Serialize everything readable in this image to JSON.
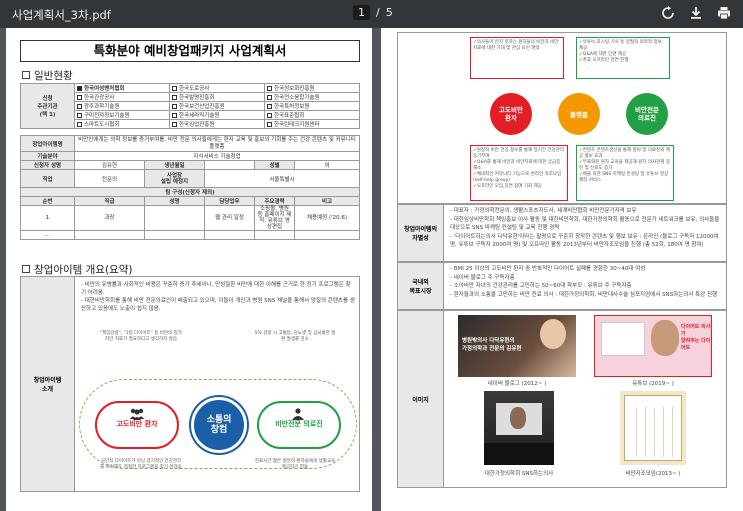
{
  "toolbar": {
    "filename": "사업계획서_3차.pdf",
    "current_page": "1",
    "separator": "/",
    "total_pages": "5"
  },
  "page1": {
    "heading": "특화분야 예비창업패키지 사업계획서",
    "general_title": "일반현황",
    "org_label": "신청\n주관기관\n(택 1)",
    "orgs": [
      {
        "name": "한국여성벤처협회",
        "checked": true
      },
      {
        "name": "한국도로공사",
        "checked": false
      },
      {
        "name": "한국정보화진흥원",
        "checked": false
      },
      {
        "name": "한국관광공사",
        "checked": false
      },
      {
        "name": "한국발명진흥회",
        "checked": false
      },
      {
        "name": "한국전소융합기술원",
        "checked": false
      },
      {
        "name": "광주과학기술원",
        "checked": false
      },
      {
        "name": "한국보건산업진흥원",
        "checked": false
      },
      {
        "name": "한국특허정보원",
        "checked": false
      },
      {
        "name": "구미전자정보기술원",
        "checked": false
      },
      {
        "name": "한국세라믹기술원",
        "checked": false
      },
      {
        "name": "한국표준협회",
        "checked": false
      },
      {
        "name": "스마트도시협회",
        "checked": false
      },
      {
        "name": "한국임업진흥원",
        "checked": false
      },
      {
        "name": "한국린테크지원센터",
        "checked": false
      }
    ],
    "idea_label": "창업아이템명",
    "idea_value": "비만인에게는 의학 정보를 증거부여를, 비만 전문 의사들에게는 환자 교육 및 홍보의 기회를 주는 건강 콘텐츠 및 커뮤니티 플랫폼",
    "tech_label": "기술분야",
    "tech_value": "지식서비스 기술창업",
    "applicant_label": "신청자 성명",
    "applicant_value": "김유현",
    "birth_label": "생년월일",
    "gender_label": "성별",
    "gender_value": "여",
    "job_label": "직업",
    "job_value": "전문의",
    "biz_place_label": "사업장\n설립 예정지",
    "biz_place_value": "서울특별시",
    "team_header": "팀 구성(신청자 제외)",
    "team_cols": [
      "순번",
      "직급",
      "성명",
      "담당업무",
      "주요경력",
      "비고"
    ],
    "team_rows": [
      [
        "1",
        "과장",
        "",
        "웹 관리 일정",
        "소핑몰, 병원 등 홈페이지 제작, 유튜브 영상편집",
        "채용예정 ('20.6)"
      ],
      [
        "...",
        "",
        "",
        "",
        "",
        ""
      ]
    ],
    "item_title": "창업아이템 개요(요약)",
    "item_label": "창업아이템\n소개",
    "item_text": [
      "- 비만의 유병률과 사회적인 비용은 꾸준히 증가 추세이나, 만성질환 비만에 대한 이해를 근거로 한 정기 프로그램은 찾기 어려움.",
      "- 대한비만학회를 통해 비만 전문의료인이 배출되고 있으며, 이들이 개인과 병원 SNS 채널을 통해서 양질의 콘텐츠를 생산하고 있음에도 노출이 쉽지 않음."
    ],
    "diagram": {
      "center": "소통의\n창컴",
      "left": "고도비만 환자",
      "right": "비만전문 의료진",
      "top_left": "\"책임감량\", \"3일 다이어트\" 등 비만의 정가치만 치료가 필요하다고 생각하지 않음",
      "top_right": "5% 감량 시 고혈압, 당뇨병 및 심뇌혈관 질환 발생률 감소",
      "bottom_left": "극단적 다이어트가 아닌 장기적인 건강관리를 하려해도 적절한 프로그램을 찾기 어려움",
      "bottom_right": "진료시간 짧은 충분히 환자들에게 생활교육 제공하기 힘듦"
    }
  },
  "page2": {
    "top_items": [
      "✓의사들이 만지 못하는 원자들의 비만과 비만치료에 대한 기대 및 관심 요인 파악",
      "✓유튜브,포스팅,기사 등 양질의 의학적 정보 제공\n✓Q&A에 대한 단면 제공\n✓추후 오프라인 강연 진행",
      "✓원정직 비만 건강 정보를 통해 장기간 건강관리 동기부여\n✓Q&A를 통해 비만과 비만치료에 대한 궁금증 해소\n✓체내적인 커뮤니티 기능으로 온라인 자조모임(self-help group)\n✓오프라인 모임,강연 참여 기회 제공",
      "✓컨텐츠 콘텐츠생산을 통해 병원 및 의료진의 제공 홍보 효과\n✓무료화된 원자 교육을 제공해 원자 의사관계 증진 및 신뢰도 증가\n✓배울 의한 SNS 마케팅 컨설팅 및 유튜브 영상 제작 서비스"
    ],
    "circles": [
      "고도비만\n환자",
      "플랫폼",
      "비만전문\n의료진"
    ],
    "diff_label": "창업아이템의\n차별성",
    "diff_text": [
      "- 대표자 : 가정의학전문의, 생활스포츠지도사, 세계비만협회 비만전문가자격 보유",
      "- 대한임상비만학회 책임홍보 이사 활동 및 대한비만학회, 대한가정의학회 활동으로 전문가 네트워크를 보유, 의사들을 대상으로 SNS 마케팅 컨설팅 및 교육 진행 경력",
      "- '다이어트하는의사 다닥유현'이라는 필명으로 꾸준히 창작한 콘텐츠 및 행보 보유 : 온라인 (블로그 구독자 12000여 명, 유튜브 구독자 2000여 명) 및 오프라인 활동 2013년부터 비만자조모임을 진행 (총 52회, 180여 명 참여)"
    ],
    "market_label": "국내외\n목표시장",
    "market_text": [
      "- BMI 25 이상의 고도비만 환자 중 반복적인 다이어트 실패를 경험한 30~40대 여성",
      "- 네이버 블로그 주 구독자층",
      "- 소아비만 자녀의 건강관리를 고민하는 50~60대 학부모 : 유튜브 주 구독자층",
      "- 환자들과의 소통을 고민하는 비만 진료 의사 : 대한가정의학회, 비만대사수술 심포지엄에서 SNS하는의사 특강 진행"
    ],
    "image_label": "이미지",
    "captions": [
      "네이버 블로그 (2012~ )",
      "유튜브 (2019~ )",
      "대한가정의학회 SNS하는의사",
      "비만자조모임(2013~ )"
    ],
    "thumb_text": [
      "병원밖의사 다닥유현의\n가정의학과 전문의 김유현",
      "다이어트 의사가\n알려주는 다이어트"
    ]
  },
  "colors": {
    "red": "#e31e24",
    "orange": "#f39800",
    "green": "#22a045"
  }
}
